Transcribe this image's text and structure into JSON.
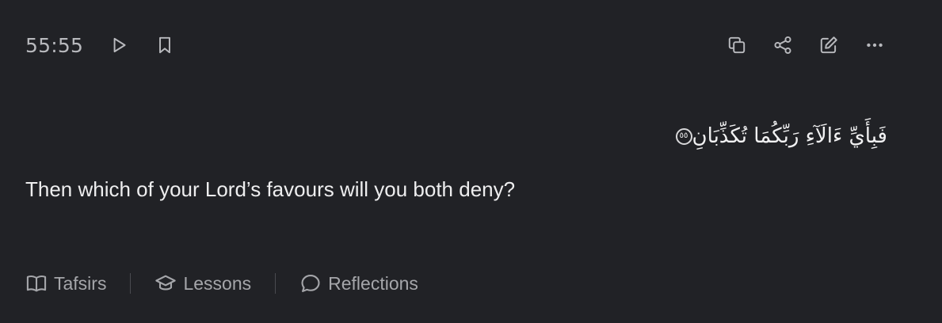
{
  "verse": {
    "key": "55:55",
    "arabic": "فَبِأَيِّ ءَالَآءِ رَبِّكُمَا تُكَذِّبَانِ",
    "ayah_number": "٥٥",
    "translation": "Then which of your Lord’s favours will you both deny?"
  },
  "toolbar": {
    "left_icons": [
      "play-icon",
      "bookmark-icon"
    ],
    "right_icons": [
      "copy-icon",
      "share-icon",
      "edit-icon",
      "more-icon"
    ]
  },
  "footer": {
    "tabs": [
      {
        "label": "Tafsirs",
        "icon": "book-icon"
      },
      {
        "label": "Lessons",
        "icon": "graduation-cap-icon"
      },
      {
        "label": "Reflections",
        "icon": "chat-bubble-icon"
      }
    ]
  },
  "colors": {
    "background": "#212226",
    "text": "#eeeeef",
    "muted": "#a5a6aa"
  }
}
